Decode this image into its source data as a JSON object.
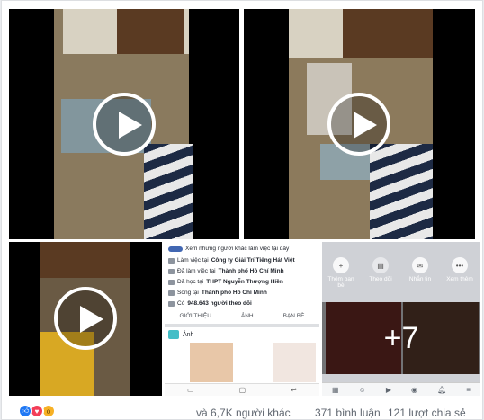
{
  "footer": {
    "reactions": [
      "like-icon",
      "love-icon",
      "wow-icon"
    ],
    "reaction_summary": "và 6,7K người khác",
    "comments": "371 bình luận",
    "shares": "121 lượt chia sẻ"
  },
  "overlay_count": "+7",
  "profile_screen": {
    "rows": [
      {
        "icon": "briefcase-icon",
        "text": "Làm việc tại ",
        "bold": "Công ty Giải Trí Tiếng Hát Việt"
      },
      {
        "icon": "briefcase-icon",
        "text": "Đã làm việc tại ",
        "bold": "Thành phố Hồ Chí Minh"
      },
      {
        "icon": "school-icon",
        "text": "Đã học tại ",
        "bold": "THPT Nguyễn Thượng Hiền"
      },
      {
        "icon": "home-icon",
        "text": "Sống tại ",
        "bold": "Thành phố Hồ Chí Minh"
      },
      {
        "icon": "rss-icon",
        "text": "Có ",
        "bold": "948.643 người theo dõi"
      }
    ],
    "see_others": "Xem những người khác làm việc tại đây",
    "tabs": [
      "GIỚI THIỆU",
      "ẢNH",
      "BẠN BÈ"
    ],
    "photos_label": "Ảnh"
  },
  "app_screen": {
    "actions": [
      {
        "label": "Thêm bạn bè",
        "icon": "add-friend-icon"
      },
      {
        "label": "Theo dõi",
        "icon": "follow-icon"
      },
      {
        "label": "Nhắn tin",
        "icon": "messenger-icon"
      },
      {
        "label": "Xem thêm",
        "icon": "more-icon"
      }
    ]
  }
}
